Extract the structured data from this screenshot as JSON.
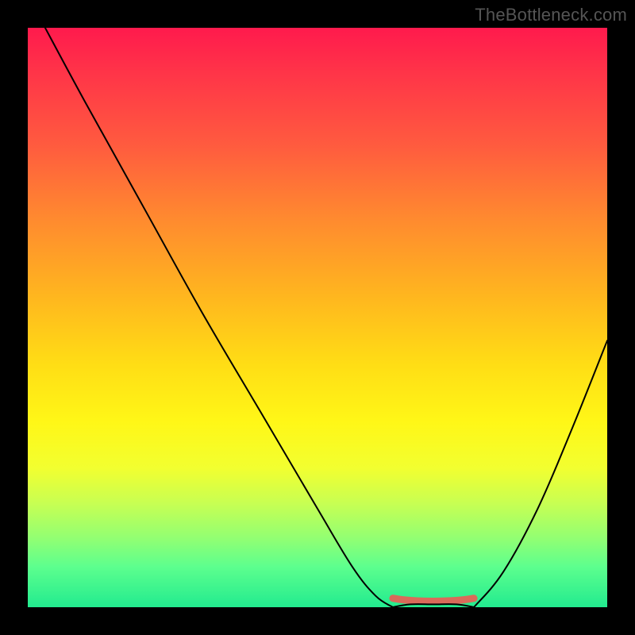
{
  "watermark": "TheBottleneck.com",
  "colors": {
    "frame_background": "#000000",
    "watermark_text": "#555555",
    "curve_stroke": "#000000",
    "trough_marker": "#d96b5a",
    "gradient_stops": [
      "#ff1a4d",
      "#ff3548",
      "#ff5a3f",
      "#ff8a2f",
      "#ffb51f",
      "#ffdd15",
      "#fff717",
      "#f2ff30",
      "#c8ff52",
      "#93ff72",
      "#5dff8e",
      "#22eb8f"
    ]
  },
  "chart_data": {
    "type": "line",
    "title": "",
    "xlabel": "",
    "ylabel": "",
    "xlim": [
      0,
      100
    ],
    "ylim": [
      0,
      100
    ],
    "note": "Axes unlabeled in source image; x/y are normalized percentages (0–100). y=0 is the green bottom edge, y=100 the red top.",
    "series": [
      {
        "name": "left-branch",
        "x": [
          3,
          10,
          20,
          30,
          40,
          50,
          56,
          60,
          63
        ],
        "y": [
          100,
          87,
          69,
          51,
          34,
          17,
          7,
          2,
          0
        ]
      },
      {
        "name": "trough",
        "x": [
          63,
          66,
          70,
          74,
          77
        ],
        "y": [
          0,
          0.5,
          0.5,
          0.5,
          0
        ]
      },
      {
        "name": "right-branch",
        "x": [
          77,
          82,
          88,
          94,
          100
        ],
        "y": [
          0,
          6,
          17,
          31,
          46
        ]
      }
    ],
    "annotations": [
      {
        "name": "trough-marker",
        "shape": "horizontal-segment",
        "x_start": 63,
        "x_end": 77,
        "y": 1,
        "color": "#d96b5a"
      }
    ]
  }
}
